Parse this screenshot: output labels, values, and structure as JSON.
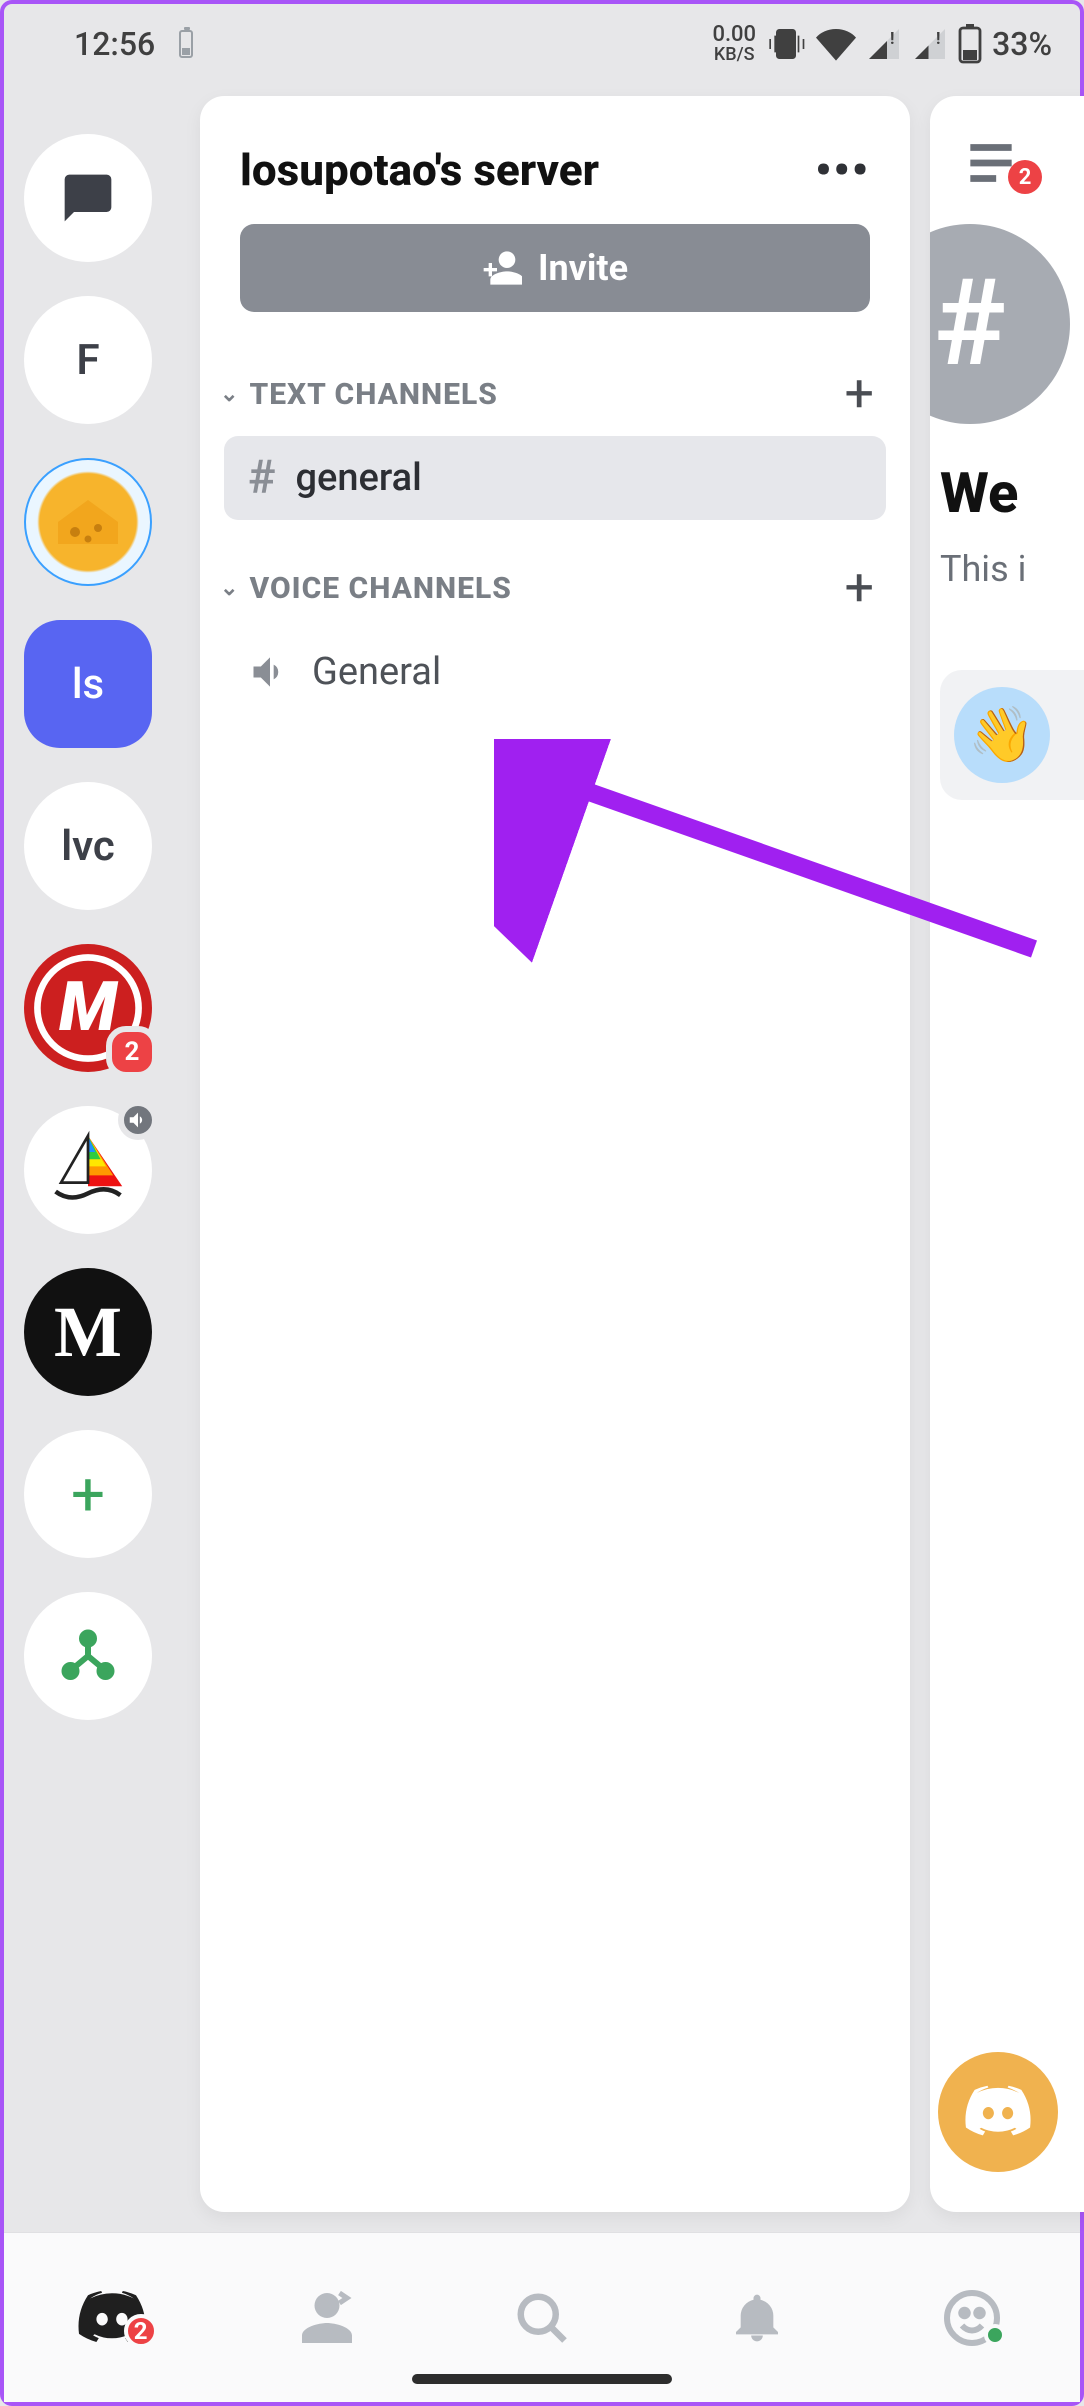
{
  "status": {
    "time": "12:56",
    "kbs_top": "0.00",
    "kbs_bottom": "KB/S",
    "battery_text": "33%"
  },
  "servers": {
    "dm_icon": "messages",
    "list": [
      {
        "label": "F",
        "type": "text"
      },
      {
        "label": "cheese",
        "type": "cheese"
      },
      {
        "label": "ls",
        "type": "purple"
      },
      {
        "label": "lvc",
        "type": "text"
      },
      {
        "label": "M",
        "type": "red",
        "badge": "2"
      },
      {
        "label": "boat",
        "type": "boat",
        "voice": true
      },
      {
        "label": "M",
        "type": "dark"
      }
    ],
    "add_label": "+",
    "hub_label": "hub"
  },
  "server_panel": {
    "title": "losupotao's server",
    "invite_label": "Invite",
    "sections": {
      "text": {
        "label": "TEXT CHANNELS",
        "channels": [
          {
            "name": "general",
            "selected": true
          }
        ]
      },
      "voice": {
        "label": "VOICE CHANNELS",
        "channels": [
          {
            "name": "General",
            "selected": false
          }
        ]
      }
    }
  },
  "peek": {
    "menu_badge": "2",
    "welcome": "We",
    "subtitle": "This i"
  },
  "bottom_nav": {
    "home_badge": "2"
  }
}
